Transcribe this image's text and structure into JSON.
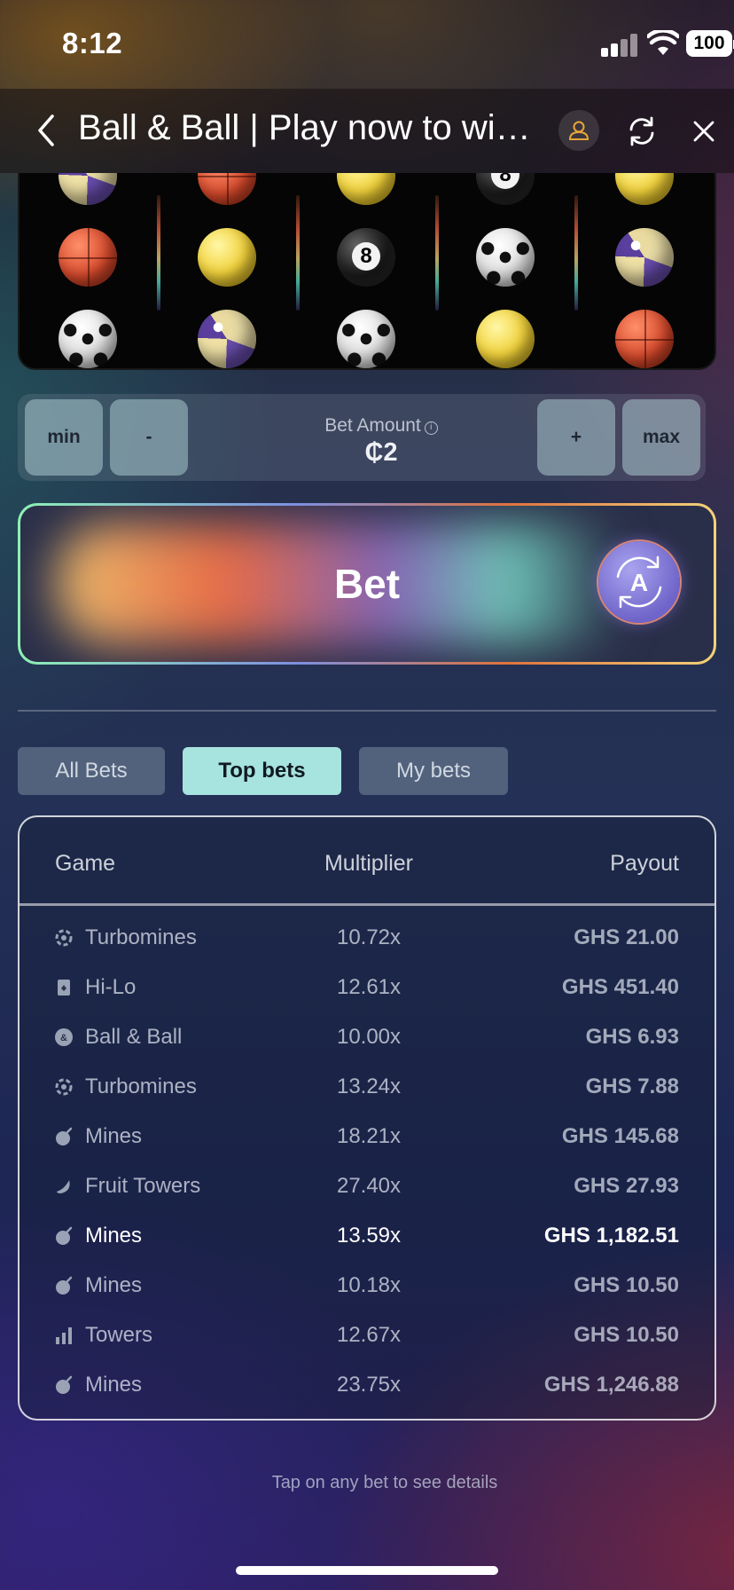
{
  "status_bar": {
    "time": "8:12",
    "battery": "100"
  },
  "header": {
    "title": "Ball & Ball | Play now to win..."
  },
  "slot": {
    "rows": [
      [
        "volley",
        "basket",
        "tennis",
        "eight",
        "tennis"
      ],
      [
        "basket",
        "tennis",
        "eight",
        "soccer",
        "volley"
      ],
      [
        "soccer",
        "volley",
        "soccer",
        "tennis",
        "basket"
      ]
    ],
    "eight_label": "8"
  },
  "bet_controls": {
    "min_label": "min",
    "minus_label": "-",
    "amount_label": "Bet Amount",
    "amount_value": "₵2",
    "plus_label": "+",
    "max_label": "max",
    "bet_label": "Bet",
    "auto_label": "A"
  },
  "tabs": [
    {
      "label": "All Bets",
      "active": false
    },
    {
      "label": "Top bets",
      "active": true
    },
    {
      "label": "My bets",
      "active": false
    }
  ],
  "table": {
    "columns": {
      "game": "Game",
      "multiplier": "Multiplier",
      "payout": "Payout"
    },
    "rows": [
      {
        "icon": "turbomines-icon",
        "game": "Turbomines",
        "multiplier": "10.72x",
        "payout": "GHS 21.00",
        "highlight": false
      },
      {
        "icon": "hilo-icon",
        "game": "Hi-Lo",
        "multiplier": "12.61x",
        "payout": "GHS 451.40",
        "highlight": false
      },
      {
        "icon": "ballandball-icon",
        "game": "Ball & Ball",
        "multiplier": "10.00x",
        "payout": "GHS 6.93",
        "highlight": false
      },
      {
        "icon": "turbomines-icon",
        "game": "Turbomines",
        "multiplier": "13.24x",
        "payout": "GHS 7.88",
        "highlight": false
      },
      {
        "icon": "mines-icon",
        "game": "Mines",
        "multiplier": "18.21x",
        "payout": "GHS 145.68",
        "highlight": false
      },
      {
        "icon": "fruit-towers-icon",
        "game": "Fruit Towers",
        "multiplier": "27.40x",
        "payout": "GHS 27.93",
        "highlight": false
      },
      {
        "icon": "mines-icon",
        "game": "Mines",
        "multiplier": "13.59x",
        "payout": "GHS 1,182.51",
        "highlight": true
      },
      {
        "icon": "mines-icon",
        "game": "Mines",
        "multiplier": "10.18x",
        "payout": "GHS 10.50",
        "highlight": false
      },
      {
        "icon": "towers-icon",
        "game": "Towers",
        "multiplier": "12.67x",
        "payout": "GHS 10.50",
        "highlight": false
      },
      {
        "icon": "mines-icon",
        "game": "Mines",
        "multiplier": "23.75x",
        "payout": "GHS 1,246.88",
        "highlight": false
      }
    ]
  },
  "footer": {
    "hint": "Tap on any bet to see details"
  }
}
